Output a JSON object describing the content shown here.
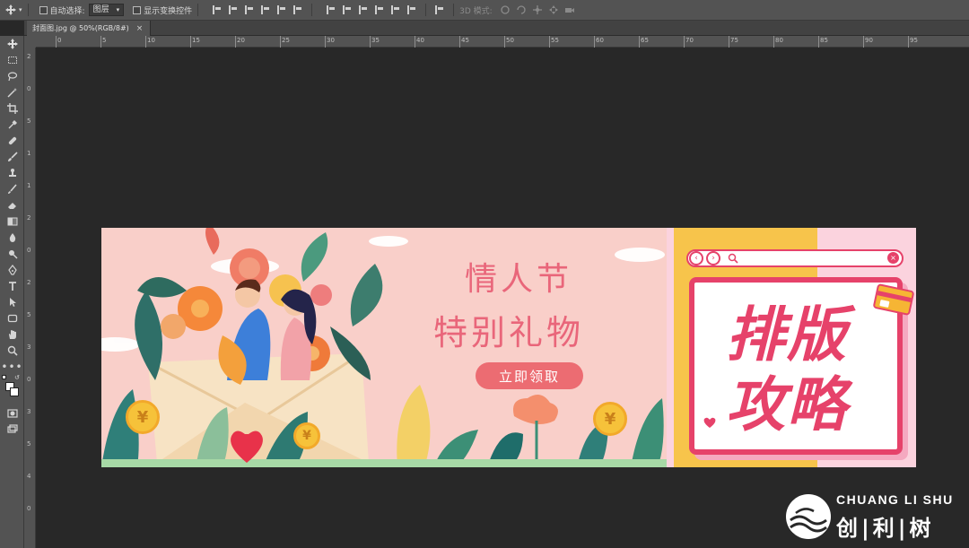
{
  "options_bar": {
    "auto_select_label": "自动选择:",
    "auto_select_value": "图层",
    "show_transform_label": "显示变换控件",
    "mode_3d_label": "3D 模式:"
  },
  "document_tab": {
    "title": "封面图.jpg @ 50%(RGB/8#)",
    "close_glyph": "×"
  },
  "ruler_top_labels": [
    "0",
    "5",
    "10",
    "15",
    "20",
    "25",
    "30",
    "35",
    "40",
    "45",
    "50",
    "55",
    "60",
    "65",
    "70",
    "75",
    "80",
    "85",
    "90",
    "95"
  ],
  "ruler_left_labels": [
    "2",
    "0",
    "5",
    "1",
    "1",
    "2",
    "0",
    "2",
    "5",
    "3",
    "0",
    "3",
    "5",
    "4",
    "0"
  ],
  "banner": {
    "headline_line1": "情人节",
    "headline_line2": "特别礼物",
    "claim_button": "立即领取",
    "coin_symbol": "¥",
    "card_line1": "排版",
    "card_line2": "攻略"
  },
  "watermark": {
    "latin": "CHUANG LI SHU",
    "chinese": "创|利|树"
  },
  "colors": {
    "ps_panel": "#535353",
    "canvas_bg": "#282828",
    "banner_pink": "#f9cfc9",
    "headline_pink": "#e9667a",
    "button_coral": "#ec6c72",
    "card_magenta": "#e6426a",
    "coin_gold": "#f6c23a"
  }
}
